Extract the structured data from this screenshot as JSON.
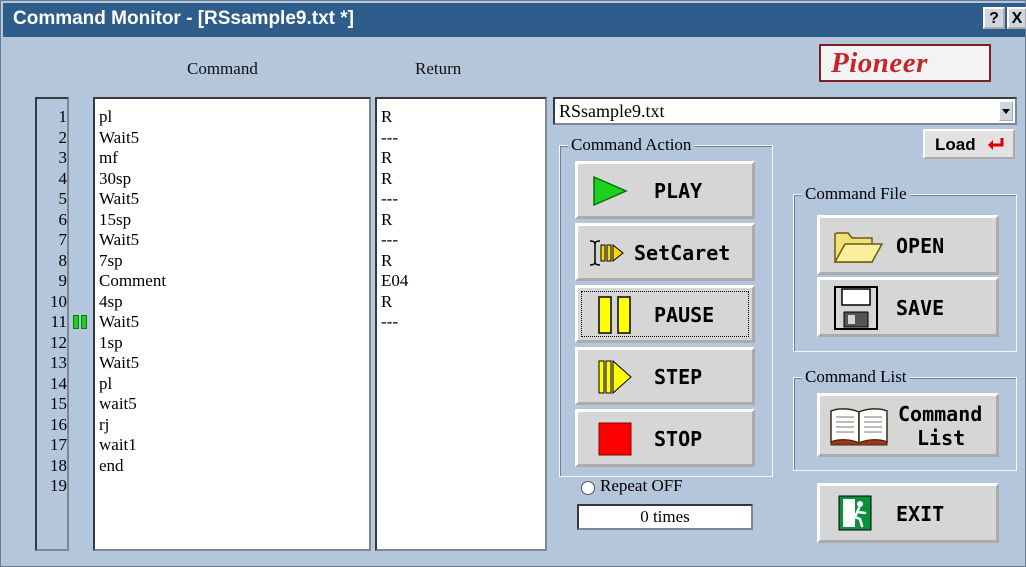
{
  "window": {
    "title": "Command Monitor - [RSsample9.txt *]",
    "help_label": "?",
    "close_label": "X"
  },
  "logo_text": "Pioneer",
  "columns": {
    "command": "Command",
    "return": "Return"
  },
  "line_numbers": [
    "1",
    "2",
    "3",
    "4",
    "5",
    "6",
    "7",
    "8",
    "9",
    "10",
    "11",
    "12",
    "13",
    "14",
    "15",
    "16",
    "17",
    "18",
    "19"
  ],
  "commands": [
    "pl",
    "Wait5",
    "mf",
    "30sp",
    "Wait5",
    "15sp",
    "Wait5",
    "7sp",
    "Comment",
    "4sp",
    "Wait5",
    "1sp",
    "Wait5",
    "pl",
    "wait5",
    "rj",
    "wait1",
    "end"
  ],
  "returns": [
    "R",
    "---",
    "R",
    "R",
    "---",
    "R",
    "---",
    "R",
    "E04",
    "R",
    "---"
  ],
  "current_line": 11,
  "file": {
    "selected": "RSsample9.txt",
    "load_label": "Load"
  },
  "command_action": {
    "group_label": "Command Action",
    "play": "PLAY",
    "setcaret": "SetCaret",
    "pause": "PAUSE",
    "step": "STEP",
    "stop": "STOP",
    "repeat_label": "Repeat OFF",
    "repeat_count": "0 times"
  },
  "command_file": {
    "group_label": "Command File",
    "open": "OPEN",
    "save": "SAVE"
  },
  "command_list": {
    "group_label": "Command List",
    "button_line1": "Command",
    "button_line2": "List"
  },
  "exit_label": "EXIT",
  "colors": {
    "title_bar": "#2e5d8b",
    "window_bg": "#b4c6dc",
    "play_icon": "#1fd11f",
    "pause_icon": "#ffff00",
    "stop_icon": "#ff0000",
    "marker": "#1fd11f",
    "brand": "#c4262b"
  },
  "icons": {
    "play": "play-triangle-icon",
    "setcaret": "setcaret-icon",
    "pause": "pause-icon",
    "step": "step-icon",
    "stop": "stop-square-icon",
    "open": "folder-icon",
    "save": "floppy-disk-icon",
    "command_list": "book-icon",
    "exit": "exit-door-icon",
    "load": "enter-arrow-icon"
  }
}
